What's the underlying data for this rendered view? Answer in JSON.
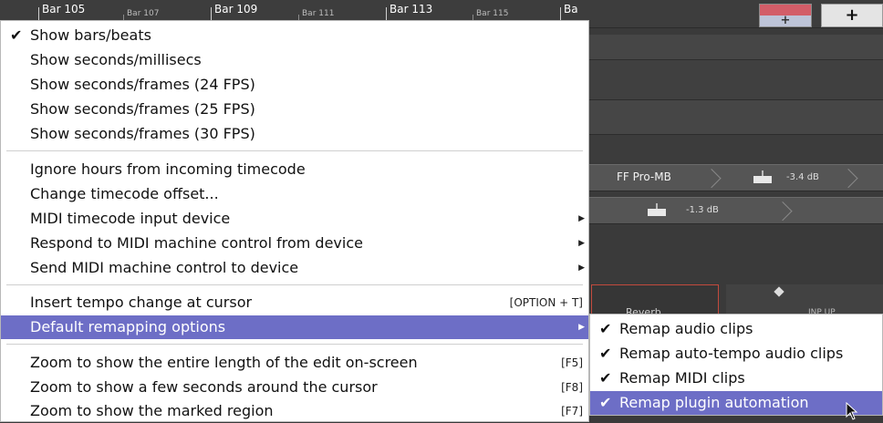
{
  "ruler": {
    "bars": [
      {
        "label": "Bar 105",
        "major": true
      },
      {
        "label": "Bar 107",
        "major": false
      },
      {
        "label": "Bar 109",
        "major": true
      },
      {
        "label": "Bar 111",
        "major": false
      },
      {
        "label": "Bar 113",
        "major": true
      },
      {
        "label": "Bar 115",
        "major": false
      },
      {
        "label": "Ba",
        "major": true
      }
    ],
    "add_tab_label": "+",
    "add_track_label": "+"
  },
  "tracks": {
    "plugin_1": {
      "name": "FF Pro-MB",
      "gain": "-3.4 dB"
    },
    "plugin_2": {
      "gain": "-1.3 dB"
    },
    "reverb_label": "Reverb",
    "reverb_tag": "INP  UP"
  },
  "menu": {
    "items": [
      {
        "label": "Show bars/beats",
        "check": "✔"
      },
      {
        "label": "Show seconds/millisecs"
      },
      {
        "label": "Show seconds/frames (24 FPS)"
      },
      {
        "label": "Show seconds/frames (25 FPS)"
      },
      {
        "label": "Show seconds/frames (30 FPS)"
      },
      {
        "label": "Ignore hours from incoming timecode"
      },
      {
        "label": "Change timecode offset..."
      },
      {
        "label": "MIDI timecode input device",
        "arrow": "▶"
      },
      {
        "label": "Respond to MIDI machine control from device",
        "arrow": "▶"
      },
      {
        "label": "Send MIDI machine control to device",
        "arrow": "▶"
      },
      {
        "label": "Insert tempo change at cursor",
        "shortcut": "[OPTION + T]"
      },
      {
        "label": "Default remapping options",
        "arrow": "▶"
      },
      {
        "label": "Zoom to show the entire length of the edit on-screen",
        "shortcut": "[F5]"
      },
      {
        "label": "Zoom to show a few seconds around the cursor",
        "shortcut": "[F8]"
      },
      {
        "label": "Zoom to show the marked region",
        "shortcut": "[F7]"
      }
    ]
  },
  "submenu": {
    "items": [
      {
        "label": "Remap audio clips",
        "check": "✔"
      },
      {
        "label": "Remap auto-tempo audio clips",
        "check": "✔"
      },
      {
        "label": "Remap MIDI clips",
        "check": "✔"
      },
      {
        "label": "Remap plugin automation",
        "check": "✔"
      }
    ]
  },
  "colors": {
    "highlight": "#6d6ec6",
    "menu_bg": "#ffffff",
    "daw_bg": "#3a3a3a",
    "reverb_border": "#c24a3d"
  }
}
